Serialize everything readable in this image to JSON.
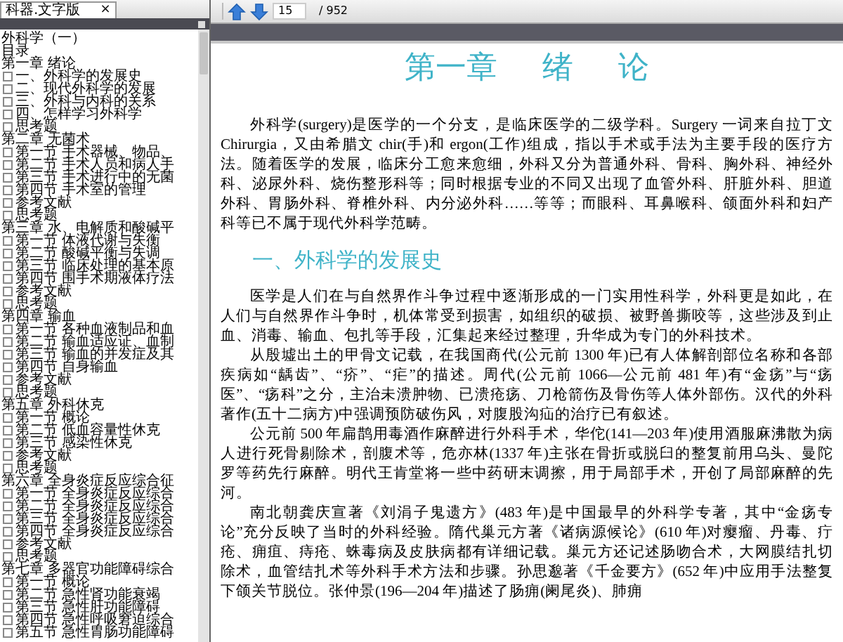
{
  "toolbar": {
    "page": "15",
    "total": "/ 952"
  },
  "tab": {
    "title": "科器.文字版",
    "close": "×"
  },
  "sidebar": {
    "items": [
      {
        "label": "外科学（一）"
      },
      {
        "label": "目录"
      },
      {
        "label": "第一章 绪论",
        "children": [
          {
            "label": "一、外科学的发展史"
          },
          {
            "label": "二、现代外科学的发展"
          },
          {
            "label": "三、外科与内科的关系"
          },
          {
            "label": "四、怎样学习外科学"
          },
          {
            "label": "思考题"
          }
        ]
      },
      {
        "label": "第二章 无菌术",
        "children": [
          {
            "label": "第一节 手术器械、物品、"
          },
          {
            "label": "第二节 手术人员和病人手"
          },
          {
            "label": "第三节 手术进行中的无菌"
          },
          {
            "label": "第四节 手术室的管理"
          },
          {
            "label": "参考文献"
          },
          {
            "label": "思考题"
          }
        ]
      },
      {
        "label": "第三章 水、电解质和酸碱平",
        "children": [
          {
            "label": "第一节 体液代谢与失衡"
          },
          {
            "label": "第二节 酸碱平衡与失调"
          },
          {
            "label": "第三节 临床处理的基本原"
          },
          {
            "label": "第四节 围手术期液体疗法"
          },
          {
            "label": "参考文献"
          },
          {
            "label": "思考题"
          }
        ]
      },
      {
        "label": "第四章 输血",
        "children": [
          {
            "label": "第一节 各种血液制品和血"
          },
          {
            "label": "第二节 输血适应证、血制"
          },
          {
            "label": "第三节 输血的并发症及其"
          },
          {
            "label": "第四节 自身输血"
          },
          {
            "label": "参考文献"
          },
          {
            "label": "思考题"
          }
        ]
      },
      {
        "label": "第五章 外科休克",
        "children": [
          {
            "label": "第一节 概论"
          },
          {
            "label": "第二节 低血容量性休克"
          },
          {
            "label": "第三节 感染性休克"
          },
          {
            "label": "参考文献"
          },
          {
            "label": "思考题"
          }
        ]
      },
      {
        "label": "第六章 全身炎症反应综合征",
        "children": [
          {
            "label": "第一节 全身炎症反应综合"
          },
          {
            "label": "第二节 全身炎症反应综合"
          },
          {
            "label": "第三节 全身炎症反应综合"
          },
          {
            "label": "第四节 全身炎症反应综合"
          },
          {
            "label": "参考文献"
          },
          {
            "label": "思考题"
          }
        ]
      },
      {
        "label": "第七章 多器官功能障碍综合",
        "children": [
          {
            "label": "第一节 概论"
          },
          {
            "label": "第二节 急性肾功能衰竭"
          },
          {
            "label": "第三节 急性肝功能障碍"
          },
          {
            "label": "第四节 急性呼吸窘迫综合"
          },
          {
            "label": "第五节 急性胃肠功能障碍"
          }
        ]
      }
    ]
  },
  "document": {
    "title": "第一章 绪 论",
    "blocks": [
      {
        "kind": "paragraph",
        "text": "外科学(surgery)是医学的一个分支，是临床医学的二级学科。Surgery 一词来自拉丁文 Chirurgia，又由希腊文 chir(手)和 ergon(工作)组成，指以手术或手法为主要手段的医疗方法。随着医学的发展，临床分工愈来愈细，外科又分为普通外科、骨科、胸外科、神经外科、泌尿外科、烧伤整形科等；同时根据专业的不同又出现了血管外科、肝脏外科、胆道外科、胃肠外科、脊椎外科、内分泌外科……等等；而眼科、耳鼻喉科、颌面外科和妇产科等已不属于现代外科学范畴。"
      },
      {
        "kind": "heading",
        "text": "一、外科学的发展史"
      },
      {
        "kind": "paragraph",
        "text": "医学是人们在与自然界作斗争过程中逐渐形成的一门实用性科学，外科更是如此，在人们与自然界作斗争时，机体常受到损害，如组织的破损、被野兽撕咬等，这些涉及到止血、消毒、输血、包扎等手段，汇集起来经过整理，升华成为专门的外科技术。"
      },
      {
        "kind": "paragraph",
        "text": "从殷墟出土的甲骨文记载，在我国商代(公元前 1300 年)已有人体解剖部位名称和各部疾病如“龋齿”、“疥”、“疟”的描述。周代(公元前 1066—公元前 481 年)有“金疡”与“疡医”、“疡科”之分，主治未溃肿物、已溃疮疡、刀枪箭伤及骨伤等人体外部伤。汉代的外科著作(五十二病方)中强调预防破伤风，对腹股沟疝的治疗已有叙述。"
      },
      {
        "kind": "paragraph",
        "text": "公元前 500 年扁鹊用毒酒作麻醉进行外科手术，华佗(141—203 年)使用酒服麻沸散为病人进行死骨剔除术，剖腹术等，危亦林(1337 年)主张在骨折或脱臼的整复前用乌头、曼陀罗等药先行麻醉。明代王肯堂将一些中药研末调擦，用于局部手术，开创了局部麻醉的先河。"
      },
      {
        "kind": "paragraph",
        "text": "南北朝龚庆宣著《刘涓子鬼遗方》(483 年)是中国最早的外科学专著，其中“金疡专论”充分反映了当时的外科经验。隋代巢元方著《诸病源候论》(610 年)对瘿瘤、丹毒、疔疮、痈疽、痔疮、蛛毒病及皮肤病都有详细记载。巢元方还记述肠吻合术，大网膜结扎切除术，血管结扎术等外科手术方法和步骤。孙思邈著《千金要方》(652 年)中应用手法整复下颌关节脱位。张仲景(196—204 年)描述了肠痈(阑尾炎)、肺痈"
      }
    ]
  }
}
